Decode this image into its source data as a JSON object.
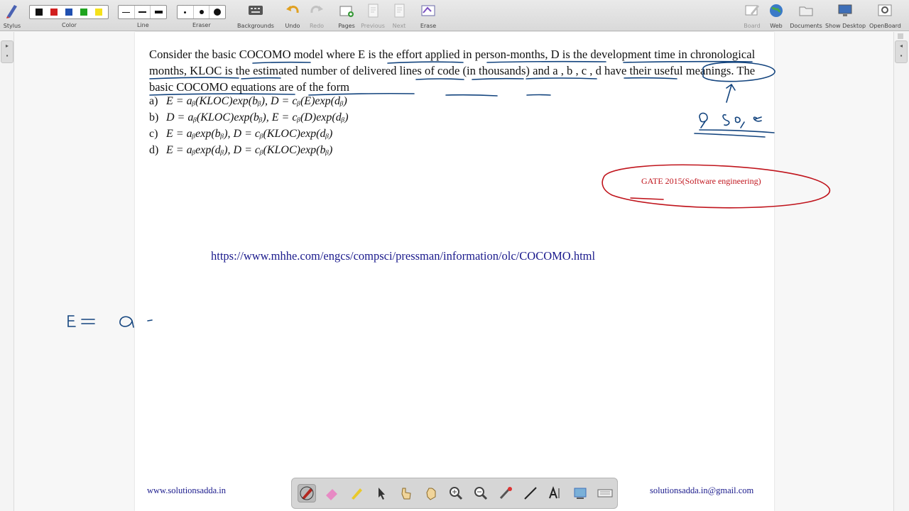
{
  "toolbar": {
    "stylus": "Stylus",
    "color": "Color",
    "colors": [
      "#111111",
      "#d11f1f",
      "#1f4fb0",
      "#1fa41f",
      "#f5e11a"
    ],
    "line": "Line",
    "eraser": "Eraser",
    "backgrounds": "Backgrounds",
    "undo": "Undo",
    "redo": "Redo",
    "pages": "Pages",
    "previous": "Previous",
    "next": "Next",
    "erase": "Erase",
    "board": "Board",
    "web": "Web",
    "documents": "Documents",
    "show_desktop": "Show Desktop",
    "openboard": "OpenBoard"
  },
  "question": {
    "text": "Consider the basic COCOMO model where E is the effort applied in person-months, D is the development time in chronological months, KLOC is the estimated number of delivered lines of code (in thousands) and a , b , c , d have their useful meanings. The basic COCOMO equations are of the form",
    "options": [
      {
        "letter": "a)",
        "expr": "E = aᵦ(KLOC)exp(bᵦ), D = cᵦ(E)exp(dᵦ)"
      },
      {
        "letter": "b)",
        "expr": "D = aᵦ(KLOC)exp(bᵦ), E = cᵦ(D)exp(dᵦ)"
      },
      {
        "letter": "c)",
        "expr": "E = aᵦexp(bᵦ), D = cᵦ(KLOC)exp(dᵦ)"
      },
      {
        "letter": "d)",
        "expr": "E = aᵦexp(dᵦ), D = cᵦ(KLOC)exp(bᵦ)"
      }
    ]
  },
  "annotations": {
    "gate_label": "GATE 2015(Software engineering)",
    "reference_url": "https://www.mhhe.com/engcs/compsci/pressman/information/olc/COCOMO.html",
    "handwriting_abc": "a , s o , e",
    "handwriting_formula": "E = a ·"
  },
  "footer": {
    "website": "www.solutionsadda.in",
    "email": "solutionsadda.in@gmail.com"
  },
  "dock_tools": [
    "pen-tool",
    "eraser-tool",
    "marker-tool",
    "selector-tool",
    "interact-tool",
    "hand-tool",
    "zoom-in-tool",
    "zoom-out-tool",
    "laser-pointer-tool",
    "line-tool",
    "text-tool",
    "capture-tool",
    "keyboard-tool"
  ]
}
